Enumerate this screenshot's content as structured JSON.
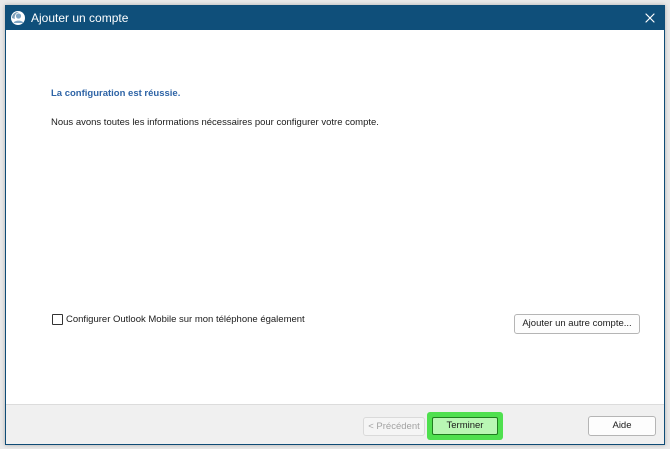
{
  "window": {
    "title": "Ajouter un compte"
  },
  "icons": {
    "app": "outlook-account-icon",
    "close": "close-icon"
  },
  "content": {
    "heading": "La configuration est réussie.",
    "description": "Nous avons toutes les informations nécessaires pour configurer votre compte.",
    "mobile_checkbox": {
      "label": "Configurer Outlook Mobile sur mon téléphone également",
      "checked": false
    },
    "add_account_label": "Ajouter un autre compte..."
  },
  "footer": {
    "previous_label": "< Précédent",
    "finish_label": "Terminer",
    "help_label": "Aide"
  },
  "colors": {
    "titlebar": "#0f4f7a",
    "heading": "#2e64a6",
    "highlight": "#4fe04f",
    "finish_button": "#b9f7b4"
  }
}
